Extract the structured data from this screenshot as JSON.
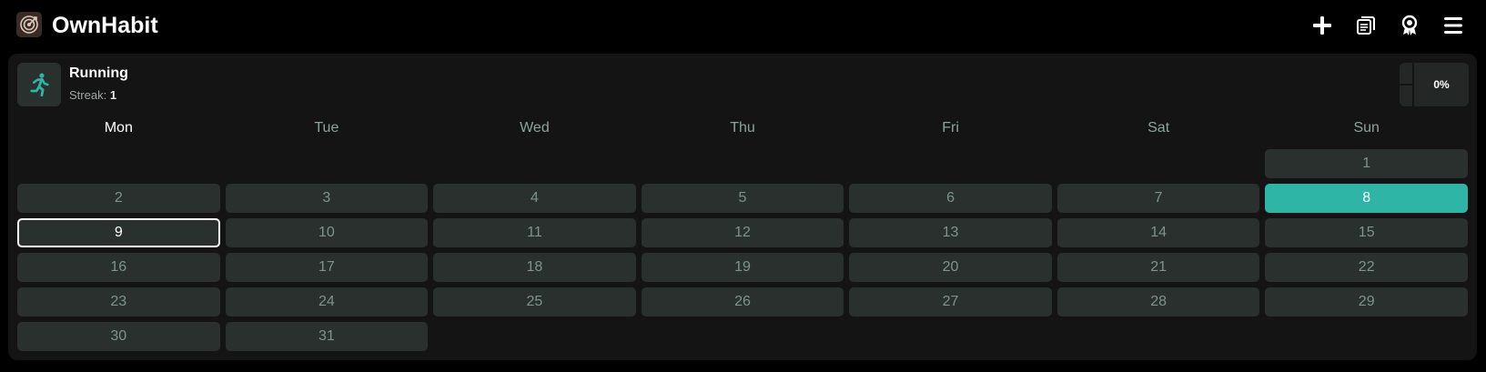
{
  "app": {
    "title": "OwnHabit",
    "logo_icon": "target-icon"
  },
  "toolbar": {
    "icons": [
      "plus-icon",
      "notebook-icon",
      "award-icon",
      "menu-icon"
    ]
  },
  "habit": {
    "name": "Running",
    "icon": "running-person-icon",
    "streak_label": "Streak:",
    "streak_value": "1",
    "progress_text": "0%",
    "progress_fraction": 0
  },
  "calendar": {
    "weekdays": [
      "Mon",
      "Tue",
      "Wed",
      "Thu",
      "Fri",
      "Sat",
      "Sun"
    ],
    "current_weekday_index": 0,
    "leading_blanks": 6,
    "days": [
      "1",
      "2",
      "3",
      "4",
      "5",
      "6",
      "7",
      "8",
      "9",
      "10",
      "11",
      "12",
      "13",
      "14",
      "15",
      "16",
      "17",
      "18",
      "19",
      "20",
      "21",
      "22",
      "23",
      "24",
      "25",
      "26",
      "27",
      "28",
      "29",
      "30",
      "31"
    ],
    "completed_days": [
      "8"
    ],
    "today": "9"
  },
  "colors": {
    "accent": "#2fb5a5",
    "background": "#000000",
    "card": "#141414",
    "cell": "#2a302e",
    "muted_text": "#7d938c"
  }
}
